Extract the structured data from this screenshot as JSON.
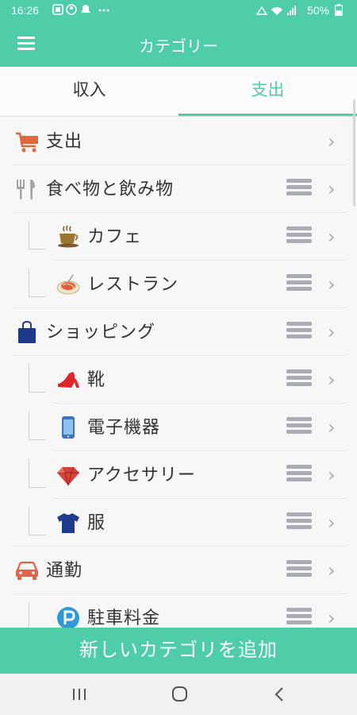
{
  "status_bar": {
    "time": "16:26",
    "battery": "50%"
  },
  "app_bar": {
    "title": "カテゴリー",
    "menu_icon": "hamburger-menu-icon"
  },
  "tabs": [
    {
      "label": "収入",
      "selected": false
    },
    {
      "label": "支出",
      "selected": true
    }
  ],
  "categories": [
    {
      "label": "支出",
      "icon": "shopping-cart-icon",
      "level": 0,
      "has_handle": false
    },
    {
      "label": "食べ物と飲み物",
      "icon": "fork-knife-icon",
      "level": 0,
      "has_handle": true
    },
    {
      "label": "カフェ",
      "icon": "coffee-cup-icon",
      "level": 1,
      "has_handle": true
    },
    {
      "label": "レストラン",
      "icon": "restaurant-dish-icon",
      "level": 1,
      "has_handle": true
    },
    {
      "label": "ショッピング",
      "icon": "shopping-bag-icon",
      "level": 0,
      "has_handle": true
    },
    {
      "label": "靴",
      "icon": "high-heel-icon",
      "level": 1,
      "has_handle": true
    },
    {
      "label": "電子機器",
      "icon": "smartphone-icon",
      "level": 1,
      "has_handle": true
    },
    {
      "label": "アクセサリー",
      "icon": "gem-icon",
      "level": 1,
      "has_handle": true
    },
    {
      "label": "服",
      "icon": "tshirt-icon",
      "level": 1,
      "has_handle": true
    },
    {
      "label": "通勤",
      "icon": "car-icon",
      "level": 0,
      "has_handle": true
    },
    {
      "label": "駐車料金",
      "icon": "parking-icon",
      "level": 1,
      "has_handle": true
    }
  ],
  "add_button": {
    "label": "新しいカテゴリを追加"
  },
  "colors": {
    "accent": "#4ecda8",
    "handle": "#a9adba"
  }
}
